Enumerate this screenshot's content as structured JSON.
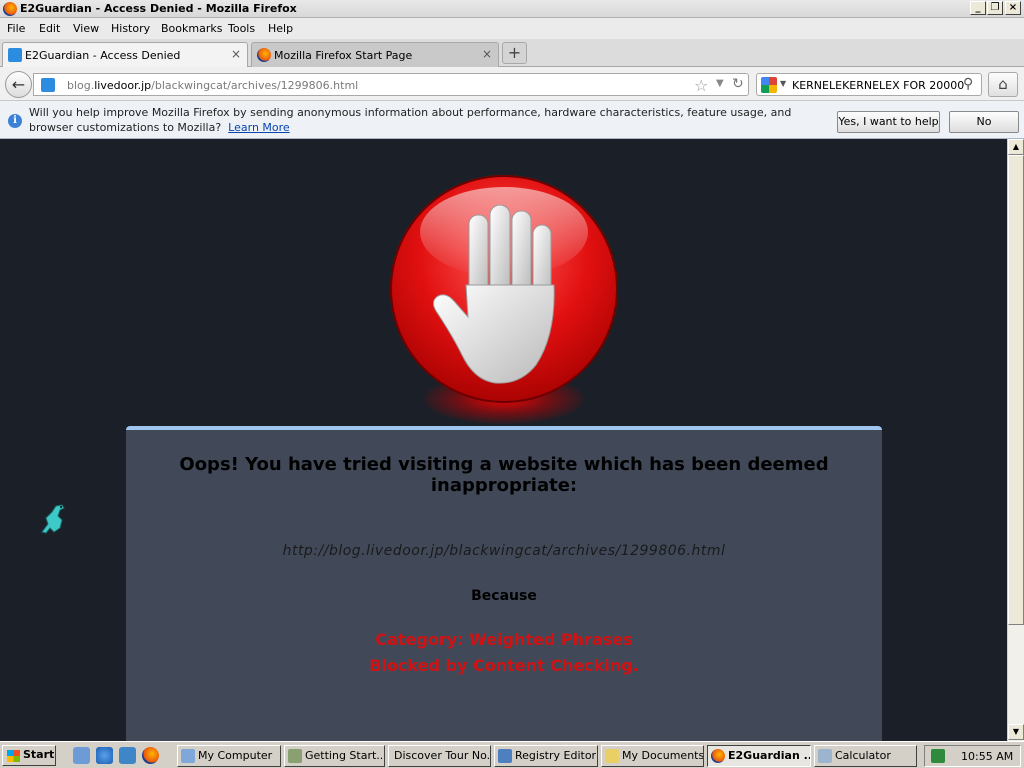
{
  "window": {
    "title": "E2Guardian - Access Denied - Mozilla Firefox"
  },
  "menu": [
    "File",
    "Edit",
    "View",
    "History",
    "Bookmarks",
    "Tools",
    "Help"
  ],
  "tabs": [
    {
      "label": "E2Guardian - Access Denied",
      "close": "×"
    },
    {
      "label": "Mozilla Firefox Start Page",
      "close": "×"
    }
  ],
  "new_tab": "+",
  "nav": {
    "url_prefix": "blog.",
    "url_domain": "livedoor.jp",
    "url_path": "/blackwingcat/archives/1299806.html",
    "search_query": "KERNELEKERNELEX FOR 20000"
  },
  "notification": {
    "message": "Will you help improve Mozilla Firefox by sending anonymous information about performance, hardware characteristics, feature usage, and browser customizations to Mozilla?",
    "learn_more": "Learn More",
    "yes_button": "Yes, I want to help",
    "no_button": "No"
  },
  "page": {
    "headline": "Oops! You have tried visiting a website which has been deemed inappropriate:",
    "blocked_url": "http://blog.livedoor.jp/blackwingcat/archives/1299806.html",
    "because": "Because",
    "reason_line1": "Category: Weighted Phrases",
    "reason_line2": "Blocked by Content Checking."
  },
  "taskbar": {
    "start": "Start",
    "tasks": [
      "My Computer",
      "Getting Start...",
      "Discover Tour No...",
      "Registry Editor",
      "My Documents",
      "E2Guardian ...",
      "Calculator"
    ],
    "clock": "10:55 AM"
  },
  "colors": {
    "reason": "#d11212",
    "panel": "#414959",
    "background": "#1b1f27",
    "accent": "#9fc6ee"
  }
}
